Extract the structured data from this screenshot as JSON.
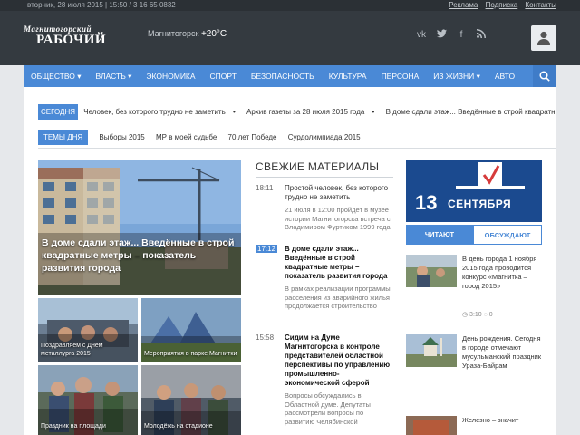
{
  "topbar": {
    "date": "вторник, 28 июля 2015   |   15:50 / 3 16 65 0832",
    "links": [
      "Реклама",
      "Подписка",
      "Контакты"
    ]
  },
  "header": {
    "logo_line1": "Магнитогорский",
    "logo_line2": "РАБОЧИЙ",
    "weather_city": "Магнитогорск",
    "weather_temp": "+20°C",
    "social_icons": [
      "vk-icon",
      "twitter-icon",
      "facebook-icon",
      "rss-icon"
    ],
    "user_icon": "user-icon"
  },
  "nav": {
    "items": [
      "ОБЩЕСТВО ▾",
      "ВЛАСТЬ ▾",
      "ЭКОНОМИКА",
      "СПОРТ",
      "БЕЗОПАСНОСТЬ",
      "КУЛЬТУРА",
      "ПЕРСОНА",
      "ИЗ ЖИЗНИ ▾",
      "АВТО"
    ],
    "search_icon": "search-icon"
  },
  "ticker": {
    "label": "СЕГОДНЯ",
    "items": [
      "Человек, без которого трудно не заметить",
      "Архив газеты за 28 июля 2015 года",
      "В доме сдали этаж... Введённые в строй квадратные метры"
    ]
  },
  "topics": {
    "label": "ТЕМЫ ДНЯ",
    "items": [
      "Выборы 2015",
      "МР в моей судьбе",
      "70 лет Победе",
      "Сурдолимпиада 2015"
    ]
  },
  "lead": {
    "caption": "В доме сдали этаж... Введённые в строй квадратные метры – показатель развития города",
    "thumbs": [
      "Поздравляем с Днём металлурга 2015",
      "Мероприятия в парке Магнитки",
      "Праздник на площади",
      "Молодёжь на стадионе"
    ]
  },
  "feed": {
    "title": "СВЕЖИЕ МАТЕРИАЛЫ",
    "items": [
      {
        "time": "18:11",
        "active": false,
        "title": "Простой человек, без которого трудно не заметить",
        "desc": "21 июля в 12:00 пройдёт в музее истории Магнитогорска встреча с Владимиром Фуртиком 1999 года"
      },
      {
        "time": "17:12",
        "active": true,
        "title": "В доме сдали этаж... Введённые в строй квадратные метры – показатель развития города",
        "desc": "В рамках реализации программы расселения из аварийного жилья продолжается строительство"
      },
      {
        "time": "15:58",
        "active": false,
        "title": "Сидим на Думе Магнитогорска в контроле представителей областной перспективы по управлению промышленно-экономической сферой",
        "desc": "Вопросы обсуждались в Областной думе. Депутаты рассмотрели вопросы по развитию Челябинской"
      }
    ]
  },
  "sidebar": {
    "banner_day": "13",
    "banner_month": "СЕНТЯБРЯ",
    "tabs": [
      "ЧИТАЮТ",
      "ОБСУЖДАЮТ"
    ],
    "news": [
      {
        "text": "В день города 1 ноября 2015 года проводится конкурс «Магнитка – город 2015»",
        "meta": "◷ 3:10   ◌ 0"
      },
      {
        "text": "День рождения. Сегодня в городе отмечают мусульманский праздник Ураза-Байрам",
        "meta": ""
      },
      {
        "text": "Железно – значит",
        "meta": ""
      }
    ]
  }
}
